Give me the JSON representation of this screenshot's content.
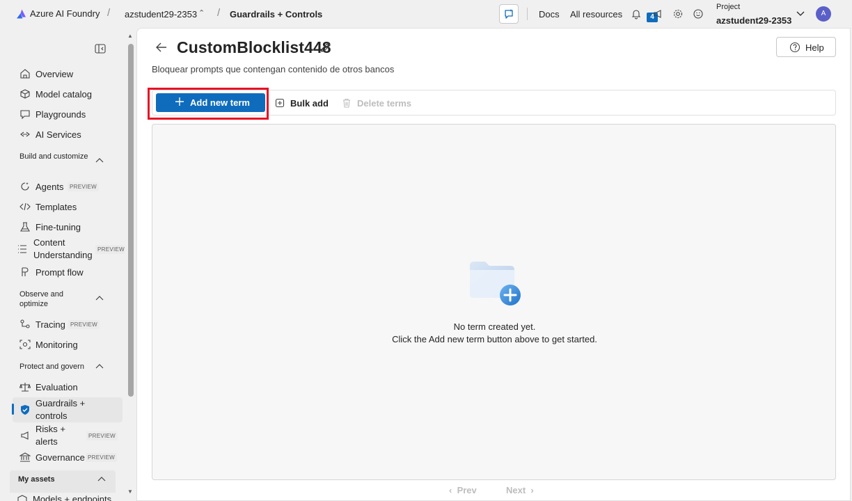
{
  "topbar": {
    "brand": "Azure AI Foundry",
    "project_crumb": "azstudent29-2353",
    "page_crumb": "Guardrails + Controls",
    "docs": "Docs",
    "all_resources": "All resources",
    "notification_count": "4",
    "project_label": "Project",
    "project_name": "azstudent29-2353",
    "avatar_initial": "A"
  },
  "sidebar": {
    "items": [
      {
        "label": "Overview",
        "icon": "home-icon"
      },
      {
        "label": "Model catalog",
        "icon": "cube-icon"
      },
      {
        "label": "Playgrounds",
        "icon": "chat-icon"
      },
      {
        "label": "AI Services",
        "icon": "link-icon"
      }
    ],
    "section_build": "Build and customize",
    "build_items": [
      {
        "label": "Agents",
        "badge": "PREVIEW"
      },
      {
        "label": "Templates"
      },
      {
        "label": "Fine-tuning"
      },
      {
        "label": "Content Understanding",
        "badge": "PREVIEW"
      },
      {
        "label": "Prompt flow"
      }
    ],
    "section_observe": "Observe and optimize",
    "observe_items": [
      {
        "label": "Tracing",
        "badge": "PREVIEW"
      },
      {
        "label": "Monitoring"
      }
    ],
    "section_protect": "Protect and govern",
    "protect_items": [
      {
        "label": "Evaluation"
      },
      {
        "label": "Guardrails + controls"
      },
      {
        "label": "Risks + alerts",
        "badge": "PREVIEW"
      },
      {
        "label": "Governance",
        "badge": "PREVIEW"
      }
    ],
    "my_assets": "My assets",
    "cut_item": "Models + endpoints"
  },
  "main": {
    "title": "CustomBlocklist448",
    "subtitle": "Bloquear prompts que contengan contenido de otros bancos",
    "help": "Help",
    "add_new_term": "Add new term",
    "bulk_add": "Bulk add",
    "delete_terms": "Delete terms",
    "empty_line1": "No term created yet.",
    "empty_line2": "Click the Add new term button above to get started.",
    "prev": "Prev",
    "next": "Next"
  },
  "colors": {
    "accent": "#0f6cbd",
    "highlight": "#e81123"
  }
}
